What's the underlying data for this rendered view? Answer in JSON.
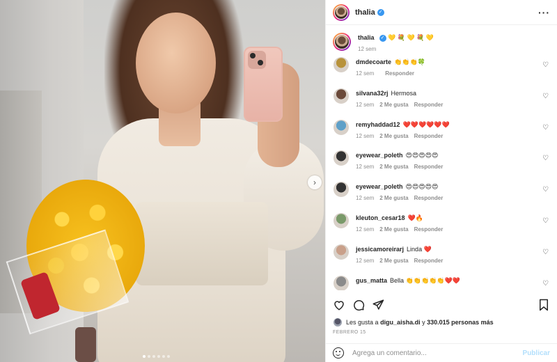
{
  "post": {
    "username": "thalia",
    "caption_emojis": "💛 💐 💛 💐 💛",
    "caption_time": "12 sem",
    "more_icon": "more-horizontal-icon"
  },
  "comments": [
    {
      "user": "dmdecoarte",
      "text": "👏👏👏🍀",
      "time": "12 sem",
      "likes": "",
      "reply": "Responder",
      "avatar_color": "#b8923a"
    },
    {
      "user": "silvana32rj",
      "text": "Hermosa",
      "time": "12 sem",
      "likes": "2 Me gusta",
      "reply": "Responder",
      "avatar_color": "#6b4a3a"
    },
    {
      "user": "remyhaddad12",
      "text": "❤️❤️❤️❤️❤️❤️",
      "time": "12 sem",
      "likes": "2 Me gusta",
      "reply": "Responder",
      "avatar_color": "#5fa0c8"
    },
    {
      "user": "eyewear_poleth",
      "text": "😍😍😍😍😍",
      "time": "12 sem",
      "likes": "2 Me gusta",
      "reply": "Responder",
      "avatar_color": "#333333"
    },
    {
      "user": "eyewear_poleth",
      "text": "😍😍😍😍😍",
      "time": "12 sem",
      "likes": "2 Me gusta",
      "reply": "Responder",
      "avatar_color": "#333333"
    },
    {
      "user": "kleuton_cesar18",
      "text": "❤️🔥",
      "time": "12 sem",
      "likes": "2 Me gusta",
      "reply": "Responder",
      "avatar_color": "#7a9a6a"
    },
    {
      "user": "jessicamoreirarj",
      "text": "Linda ❤️",
      "time": "12 sem",
      "likes": "2 Me gusta",
      "reply": "Responder",
      "avatar_color": "#c9a08a"
    },
    {
      "user": "gus_matta",
      "text": "Bella 👏👏👏👏👏❤️❤️",
      "time": "",
      "likes": "",
      "reply": "",
      "avatar_color": "#8a8a8a"
    }
  ],
  "actions": {
    "like_icon": "heart-icon",
    "comment_icon": "comment-icon",
    "share_icon": "send-icon",
    "save_icon": "bookmark-icon"
  },
  "likes_text": {
    "prefix": "Les gusta a",
    "user": "digu_aisha.di",
    "middle": "y",
    "count": "330.015 personas más"
  },
  "date": "FEBRERO 15",
  "add_comment": {
    "placeholder": "Agrega un comentario...",
    "post_label": "Publicar"
  },
  "carousel": {
    "slides": 6,
    "active": 0
  }
}
